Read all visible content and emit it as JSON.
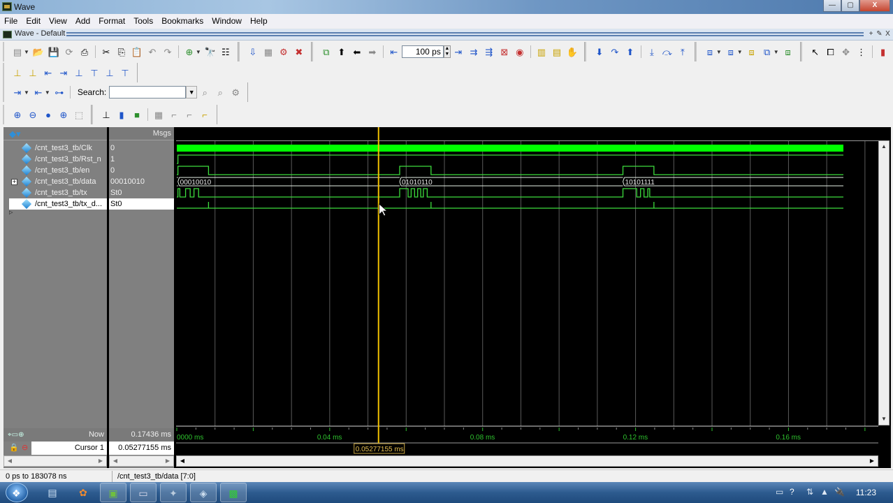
{
  "window": {
    "title": "Wave",
    "buttons": {
      "minimize": "—",
      "maximize": "▢",
      "close": "X"
    }
  },
  "menu": [
    "File",
    "Edit",
    "View",
    "Add",
    "Format",
    "Tools",
    "Bookmarks",
    "Window",
    "Help"
  ],
  "wave_pane": {
    "title": "Wave - Default",
    "controls": [
      "+",
      "✎",
      "X"
    ]
  },
  "toolbar": {
    "time_step_value": "100 ps",
    "search_label": "Search:",
    "search_value": ""
  },
  "signal_list": {
    "header_msgs": "Msgs",
    "signals": [
      {
        "name": "/cnt_test3_tb/Clk",
        "value": "0",
        "expandable": false,
        "selected": false
      },
      {
        "name": "/cnt_test3_tb/Rst_n",
        "value": "1",
        "expandable": false,
        "selected": false
      },
      {
        "name": "/cnt_test3_tb/en",
        "value": "0",
        "expandable": false,
        "selected": false
      },
      {
        "name": "/cnt_test3_tb/data",
        "value": "00010010",
        "expandable": true,
        "selected": false
      },
      {
        "name": "/cnt_test3_tb/tx",
        "value": "St0",
        "expandable": false,
        "selected": false
      },
      {
        "name": "/cnt_test3_tb/tx_d...",
        "value": "St0",
        "expandable": false,
        "selected": true
      }
    ]
  },
  "cursors": {
    "now_label": "Now",
    "now_value": "0.17436 ms",
    "cursor_label": "Cursor 1",
    "cursor_value": "0.05277155 ms",
    "cursor_time_ms": 0.05277155
  },
  "timeline": {
    "view_start_ms": 0.0,
    "view_end_ms": 0.183078,
    "sim_end_ms": 0.17436,
    "tick_labels": [
      {
        "t": 0.0,
        "label": "0000 ms"
      },
      {
        "t": 0.04,
        "label": "0.04 ms"
      },
      {
        "t": 0.08,
        "label": "0.08 ms"
      },
      {
        "t": 0.12,
        "label": "0.12 ms"
      },
      {
        "t": 0.16,
        "label": "0.16 ms"
      }
    ],
    "cursor_readout": "0.05277155 ms"
  },
  "waveforms": {
    "Clk": {
      "kind": "clock-dense"
    },
    "Rst_n": {
      "kind": "bit",
      "transitions": [
        [
          0,
          0
        ],
        [
          0.0003,
          1
        ]
      ]
    },
    "en": {
      "kind": "bit",
      "transitions": [
        [
          0,
          0
        ],
        [
          0.0003,
          1
        ],
        [
          0.0083,
          0
        ],
        [
          0.0583,
          1
        ],
        [
          0.0665,
          0
        ],
        [
          0.1167,
          1
        ],
        [
          0.1248,
          0
        ]
      ]
    },
    "data": {
      "kind": "bus",
      "segments": [
        {
          "t": 0.0003,
          "label": "00010010"
        },
        {
          "t": 0.0583,
          "label": "01010110"
        },
        {
          "t": 0.1167,
          "label": "10101111"
        }
      ]
    },
    "tx": {
      "kind": "bit",
      "transitions": [
        [
          0,
          0
        ],
        [
          0.0003,
          1
        ],
        [
          0.0008,
          0
        ],
        [
          0.0023,
          1
        ],
        [
          0.0035,
          0
        ],
        [
          0.0045,
          1
        ],
        [
          0.0057,
          0
        ],
        [
          0.0583,
          1
        ],
        [
          0.0592,
          1
        ],
        [
          0.0595,
          1
        ],
        [
          0.0605,
          0
        ],
        [
          0.0613,
          1
        ],
        [
          0.0622,
          0
        ],
        [
          0.063,
          1
        ],
        [
          0.0638,
          0
        ],
        [
          0.0645,
          1
        ],
        [
          0.0655,
          0
        ],
        [
          0.1167,
          1
        ],
        [
          0.1203,
          0
        ],
        [
          0.1213,
          1
        ],
        [
          0.1222,
          0
        ],
        [
          0.1232,
          1
        ],
        [
          0.1237,
          0
        ]
      ]
    },
    "tx_done": {
      "kind": "pulse",
      "pulses": [
        0.0083,
        0.0665,
        0.1248
      ]
    }
  },
  "status": {
    "range": "0 ps to 183078 ns",
    "selected_signal": "/cnt_test3_tb/data [7:0]"
  },
  "taskbar": {
    "clock": "11:23"
  },
  "colors": {
    "wave_green": "#00ff00",
    "wave_line": "#3ddc3d",
    "cursor": "#f2c200",
    "grid": "#5a5a5a",
    "bus_text": "#e8e8e8"
  }
}
